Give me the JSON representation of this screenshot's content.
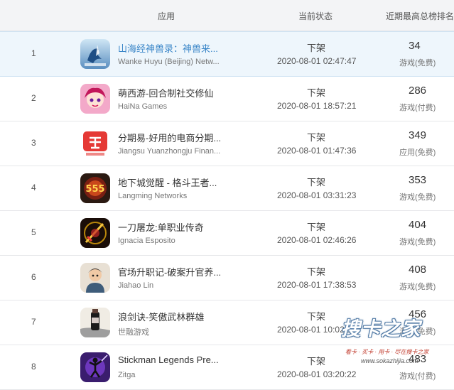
{
  "header": {
    "app_col": "应用",
    "status_col": "当前状态",
    "rank_col": "近期最高总榜排名"
  },
  "rows": [
    {
      "rank": "1",
      "name": "山海经神兽录：神兽来...",
      "developer": "Wanke Huyu (Beijing) Netw...",
      "status": "下架",
      "time": "2020-08-01 02:47:47",
      "best": "34",
      "category": "游戏(免费)",
      "icon": "shanhai-icon"
    },
    {
      "rank": "2",
      "name": "萌西游-回合制社交修仙",
      "developer": "HaiNa Games",
      "status": "下架",
      "time": "2020-08-01 18:57:21",
      "best": "286",
      "category": "游戏(付费)",
      "icon": "mengxiyou-icon"
    },
    {
      "rank": "3",
      "name": "分期易-好用的电商分期...",
      "developer": "Jiangsu Yuanzhongju Finan...",
      "status": "下架",
      "time": "2020-08-01 01:47:36",
      "best": "349",
      "category": "应用(免费)",
      "icon": "fenqiyi-icon"
    },
    {
      "rank": "4",
      "name": "地下城觉醒 - 格斗王者...",
      "developer": "Langming Networks",
      "status": "下架",
      "time": "2020-08-01 03:31:23",
      "best": "353",
      "category": "游戏(免费)",
      "icon": "dungeon-icon"
    },
    {
      "rank": "5",
      "name": "一刀屠龙:单职业传奇",
      "developer": "Ignacia Esposito",
      "status": "下架",
      "time": "2020-08-01 02:46:26",
      "best": "404",
      "category": "游戏(免费)",
      "icon": "sword-icon"
    },
    {
      "rank": "6",
      "name": "官场升职记-破案升官养...",
      "developer": "Jiahao Lin",
      "status": "下架",
      "time": "2020-08-01 17:38:53",
      "best": "408",
      "category": "游戏(免费)",
      "icon": "official-icon"
    },
    {
      "rank": "7",
      "name": "浪剑诀-笑傲武林群雄",
      "developer": "世融游戏",
      "status": "下架",
      "time": "2020-08-01 10:02:19",
      "best": "456",
      "category": "游戏(免费)",
      "icon": "langjian-icon"
    },
    {
      "rank": "8",
      "name": "Stickman Legends Pre...",
      "developer": "Zitga",
      "status": "下架",
      "time": "2020-08-01 03:20:22",
      "best": "483",
      "category": "游戏(付费)",
      "icon": "stickman-icon"
    }
  ],
  "watermark": {
    "main": "搜卡之家",
    "slogan": "看卡 · 买卡 · 用卡 · 尽在搜卡之家",
    "url": "www.sokazhijia.com"
  },
  "colors": {
    "header_bg": "#f3f4f6",
    "selected_row_bg": "#eef6fc",
    "selected_name": "#3a86c8"
  }
}
